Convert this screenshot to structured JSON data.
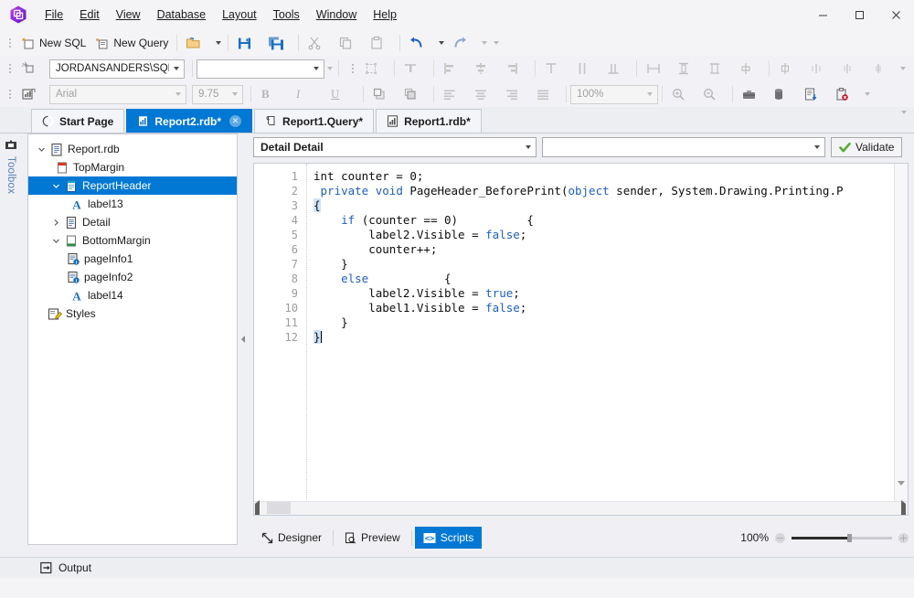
{
  "window": {
    "logo": "app-hexagon-logo",
    "controls": {
      "minimize": "─",
      "maximize": "□",
      "close": "✕"
    }
  },
  "menu": [
    {
      "label": "File"
    },
    {
      "label": "Edit"
    },
    {
      "label": "View"
    },
    {
      "label": "Database"
    },
    {
      "label": "Layout"
    },
    {
      "label": "Tools"
    },
    {
      "label": "Window"
    },
    {
      "label": "Help"
    }
  ],
  "toolbar1": {
    "new_sql": "New SQL",
    "new_query": "New Query",
    "icons": [
      "open-folder-icon",
      "save-icon",
      "save-all-icon",
      "cut-icon",
      "copy-icon",
      "paste-icon",
      "undo-icon",
      "redo-icon"
    ]
  },
  "toolbar2": {
    "connection": "JORDANSANDERS\\SQL...",
    "dataset": "",
    "icons": [
      "connection-icon",
      "select-all-icon",
      "align-top-icon",
      "align-left-icon",
      "align-center-icon",
      "align-right-icon",
      "align-text-top-icon",
      "align-middle-icon",
      "align-bottom-icon",
      "make-same-width-icon",
      "make-same-height-icon",
      "make-same-size-icon",
      "size-to-grid-icon",
      "h-spacing-equal-icon",
      "h-spacing-increase-icon",
      "h-spacing-decrease-icon",
      "h-spacing-remove-icon"
    ]
  },
  "toolbar3": {
    "font_family": "Arial",
    "font_size": "9.75",
    "bold": "B",
    "italic": "I",
    "underline": "U",
    "zoom_level": "100%",
    "icons": [
      "bring-to-front-icon",
      "send-to-back-icon",
      "text-align-left-icon",
      "text-align-center-icon",
      "text-align-right-icon",
      "text-align-justify-icon",
      "zoom-in-icon",
      "zoom-out-icon",
      "toolbox-icon",
      "data-icon",
      "report-wizard-icon",
      "clear-icon"
    ]
  },
  "tabs": [
    {
      "label": "Start Page",
      "icon": "start-page-icon",
      "active": false,
      "closable": false
    },
    {
      "label": "Report2.rdb*",
      "icon": "report-icon",
      "active": true,
      "closable": true
    },
    {
      "label": "Report1.Query*",
      "icon": "query-icon",
      "active": false,
      "closable": false
    },
    {
      "label": "Report1.rdb*",
      "icon": "report-icon",
      "active": false,
      "closable": false
    }
  ],
  "toolbox": {
    "label": "Toolbox",
    "icon": "toolbox-icon"
  },
  "tree": [
    {
      "label": "Report.rdb",
      "indent": 0,
      "twisty": "down",
      "icon": "report-doc-icon",
      "selected": false
    },
    {
      "label": "TopMargin",
      "indent": 1,
      "twisty": "",
      "icon": "top-margin-icon",
      "selected": false
    },
    {
      "label": "ReportHeader",
      "indent": 1,
      "twisty": "down",
      "icon": "report-header-icon",
      "selected": true
    },
    {
      "label": "label13",
      "indent": 2,
      "twisty": "",
      "icon": "label-icon",
      "selected": false
    },
    {
      "label": "Detail",
      "indent": 1,
      "twisty": "right",
      "icon": "detail-icon",
      "selected": false
    },
    {
      "label": "BottomMargin",
      "indent": 1,
      "twisty": "down",
      "icon": "bottom-margin-icon",
      "selected": false
    },
    {
      "label": "pageInfo1",
      "indent": 2,
      "twisty": "",
      "icon": "page-info-icon",
      "selected": false
    },
    {
      "label": "pageInfo2",
      "indent": 2,
      "twisty": "",
      "icon": "page-info-icon",
      "selected": false
    },
    {
      "label": "label14",
      "indent": 2,
      "twisty": "",
      "icon": "label-icon",
      "selected": false
    },
    {
      "label": "Styles",
      "indent": 0,
      "twisty": "",
      "icon": "styles-icon",
      "selected": false
    }
  ],
  "editor": {
    "scope_combo": "Detail  Detail",
    "event_combo": "",
    "validate_label": "Validate",
    "validate_icon": "green-check-icon",
    "line_numbers": [
      "1",
      "2",
      "3",
      "4",
      "5",
      "6",
      "7",
      "8",
      "9",
      "10",
      "11",
      "12"
    ],
    "code_lines": [
      {
        "n": 1,
        "segments": [
          {
            "t": "int counter = 0;",
            "c": "plain"
          }
        ]
      },
      {
        "n": 2,
        "segments": [
          {
            "t": " ",
            "c": "plain"
          },
          {
            "t": "private",
            "c": "kw"
          },
          {
            "t": " ",
            "c": "plain"
          },
          {
            "t": "void",
            "c": "kw"
          },
          {
            "t": " PageHeader_BeforePrint(",
            "c": "plain"
          },
          {
            "t": "object",
            "c": "kw"
          },
          {
            "t": " sender, System.Drawing.Printing.P",
            "c": "plain"
          }
        ]
      },
      {
        "n": 3,
        "segments": [
          {
            "t": "{",
            "c": "hl"
          }
        ]
      },
      {
        "n": 4,
        "segments": [
          {
            "t": "    ",
            "c": "plain"
          },
          {
            "t": "if",
            "c": "kw"
          },
          {
            "t": " (counter == 0)          {",
            "c": "plain"
          }
        ]
      },
      {
        "n": 5,
        "segments": [
          {
            "t": "        label2.Visible = ",
            "c": "plain"
          },
          {
            "t": "false",
            "c": "kw"
          },
          {
            "t": ";",
            "c": "plain"
          }
        ]
      },
      {
        "n": 6,
        "segments": [
          {
            "t": "        counter++;",
            "c": "plain"
          }
        ]
      },
      {
        "n": 7,
        "segments": [
          {
            "t": "    }",
            "c": "plain"
          }
        ]
      },
      {
        "n": 8,
        "segments": [
          {
            "t": "    ",
            "c": "plain"
          },
          {
            "t": "else",
            "c": "kw"
          },
          {
            "t": "           {",
            "c": "plain"
          }
        ]
      },
      {
        "n": 9,
        "segments": [
          {
            "t": "        label2.Visible = ",
            "c": "plain"
          },
          {
            "t": "true",
            "c": "kw"
          },
          {
            "t": ";",
            "c": "plain"
          }
        ]
      },
      {
        "n": 10,
        "segments": [
          {
            "t": "        label1.Visible = ",
            "c": "plain"
          },
          {
            "t": "false",
            "c": "kw"
          },
          {
            "t": ";",
            "c": "plain"
          }
        ]
      },
      {
        "n": 11,
        "segments": [
          {
            "t": "    }",
            "c": "plain"
          }
        ]
      },
      {
        "n": 12,
        "segments": [
          {
            "t": "}",
            "c": "hl"
          }
        ]
      }
    ]
  },
  "viewtabs": [
    {
      "label": "Designer",
      "icon": "designer-icon",
      "active": false
    },
    {
      "label": "Preview",
      "icon": "preview-icon",
      "active": false
    },
    {
      "label": "Scripts",
      "icon": "scripts-icon",
      "active": true
    }
  ],
  "zoom": {
    "level": "100%",
    "minus": "zoom-out-icon",
    "plus": "zoom-in-icon"
  },
  "output": {
    "label": "Output",
    "icon": "output-icon"
  },
  "colors": {
    "accent": "#0078d4",
    "keyword": "#1d5fbf",
    "selection": "#cfe3f7",
    "chrome": "#f4f4f7"
  }
}
